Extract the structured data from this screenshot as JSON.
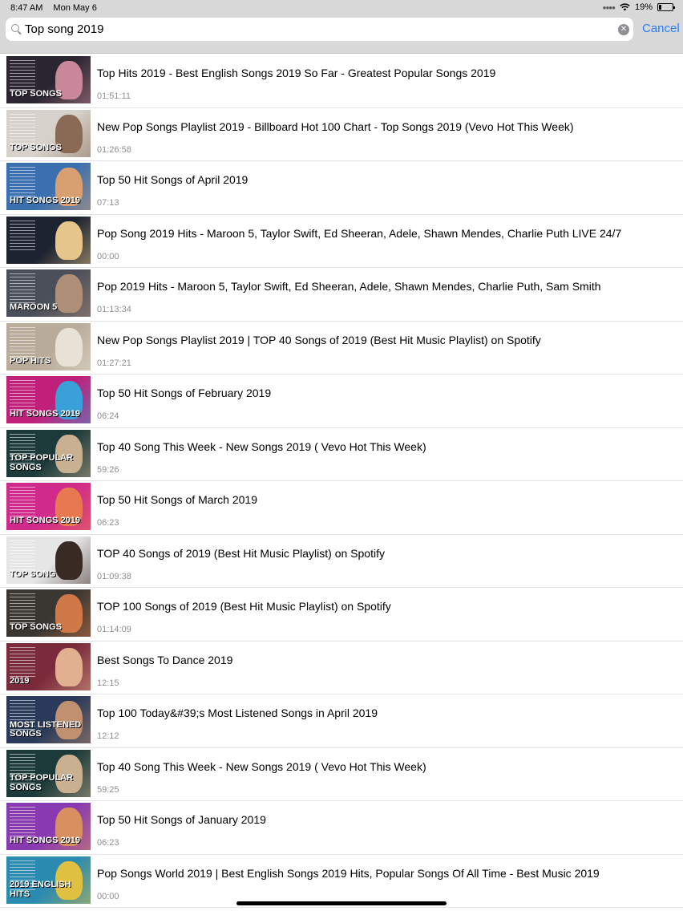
{
  "status_bar": {
    "time": "8:47 AM",
    "date": "Mon May 6",
    "battery": "19%",
    "battery_level": 0.19
  },
  "search": {
    "value": "Top song 2019",
    "cancel_label": "Cancel"
  },
  "colors": {
    "accent": "#2a7ef5",
    "meta_text": "#8e8e93",
    "bar_bg": "#d8d8d8"
  },
  "results": [
    {
      "title": "Top Hits 2019 - Best English Songs 2019 So Far - Greatest Popular Songs 2019",
      "duration": "01:51:11",
      "thumb_text": "TOP SONGS",
      "thumb_bg": "#2a2530",
      "thumb_accent": "#c9889a"
    },
    {
      "title": "New Pop Songs Playlist 2019 - Billboard Hot 100 Chart - Top Songs 2019 (Vevo Hot This Week)",
      "duration": "01:26:58",
      "thumb_text": "TOP SONGS",
      "thumb_bg": "#d6d2cb",
      "thumb_accent": "#8a6a55"
    },
    {
      "title": "Top 50 Hit Songs of April 2019",
      "duration": "07:13",
      "thumb_text": "HIT SONGS 2019",
      "thumb_bg": "#3a6fb0",
      "thumb_accent": "#d8a070"
    },
    {
      "title": "Pop Song 2019 Hits - Maroon 5, Taylor Swift, Ed Sheeran, Adele, Shawn Mendes, Charlie Puth LIVE 24/7",
      "duration": "00:00",
      "thumb_text": "",
      "thumb_bg": "#1c2230",
      "thumb_accent": "#e6c58a"
    },
    {
      "title": "Pop 2019 Hits - Maroon 5, Taylor Swift, Ed Sheeran, Adele, Shawn Mendes, Charlie Puth, Sam Smith",
      "duration": "01:13:34",
      "thumb_text": "MAROON 5",
      "thumb_bg": "#4a4f5a",
      "thumb_accent": "#b08f78"
    },
    {
      "title": "New Pop Songs Playlist 2019 | TOP 40 Songs of 2019 (Best Hit Music Playlist) on Spotify",
      "duration": "01:27:21",
      "thumb_text": "POP HITS",
      "thumb_bg": "#b8ab9a",
      "thumb_accent": "#e8e2d6"
    },
    {
      "title": "Top 50 Hit Songs of February 2019",
      "duration": "06:24",
      "thumb_text": "HIT SONGS 2019",
      "thumb_bg": "#c0207a",
      "thumb_accent": "#3aa0d8"
    },
    {
      "title": "Top 40 Song This Week - New Songs 2019 ( Vevo Hot This Week)",
      "duration": "59:26",
      "thumb_text": "TOP POPULAR SONGS",
      "thumb_bg": "#1d3a3a",
      "thumb_accent": "#c8b090"
    },
    {
      "title": "Top 50 Hit Songs of March 2019",
      "duration": "06:23",
      "thumb_text": "HIT SONGS 2019",
      "thumb_bg": "#d02a8c",
      "thumb_accent": "#e87850"
    },
    {
      "title": "TOP 40 Songs of 2019 (Best Hit Music Playlist) on Spotify",
      "duration": "01:09:38",
      "thumb_text": "TOP SONG",
      "thumb_bg": "#e6e6e6",
      "thumb_accent": "#3a2a24"
    },
    {
      "title": "TOP 100 Songs of 2019 (Best Hit Music Playlist) on Spotify",
      "duration": "01:14:09",
      "thumb_text": "TOP SONGS",
      "thumb_bg": "#3a3632",
      "thumb_accent": "#d07848"
    },
    {
      "title": "Best Songs To Dance 2019",
      "duration": "12:15",
      "thumb_text": "2019",
      "thumb_bg": "#7a2a3a",
      "thumb_accent": "#e0b090"
    },
    {
      "title": "Top 100 Today&#39;s Most Listened Songs in April 2019",
      "duration": "12:12",
      "thumb_text": "MOST LISTENED SONGS",
      "thumb_bg": "#2a3a5a",
      "thumb_accent": "#c09070"
    },
    {
      "title": "Top 40 Song This Week - New Songs 2019 ( Vevo Hot This Week)",
      "duration": "59:25",
      "thumb_text": "TOP POPULAR SONGS",
      "thumb_bg": "#1d3a3a",
      "thumb_accent": "#c8b090"
    },
    {
      "title": "Top 50 Hit Songs of January 2019",
      "duration": "06:23",
      "thumb_text": "HIT SONGS 2019",
      "thumb_bg": "#8a3ab0",
      "thumb_accent": "#d89060"
    },
    {
      "title": "Pop Songs World 2019 | Best English Songs 2019 Hits, Popular Songs Of All Time - Best Music 2019",
      "duration": "00:00",
      "thumb_text": "2019 ENGLISH HITS",
      "thumb_bg": "#2a8ab0",
      "thumb_accent": "#e0c040"
    }
  ]
}
